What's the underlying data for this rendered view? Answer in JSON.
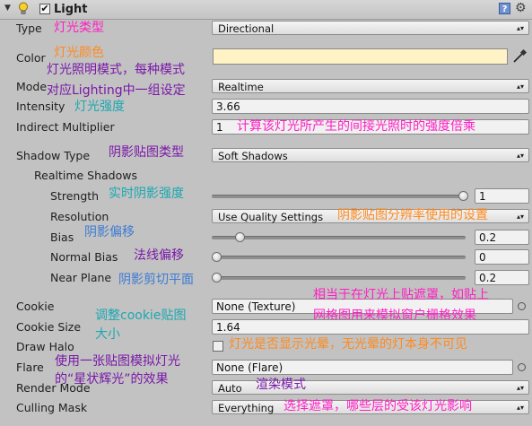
{
  "header": {
    "title": "Light",
    "enabled": true
  },
  "rows": {
    "type": {
      "label": "Type",
      "value": "Directional",
      "note": "灯光类型"
    },
    "color": {
      "label": "Color",
      "swatch": "#fff3c6",
      "note": "灯光颜色"
    },
    "mode": {
      "label": "Mode",
      "value": "Realtime",
      "note_line1": "灯光照明模式，每种模式",
      "note_line2": "对应Lighting中一组设定"
    },
    "intensity": {
      "label": "Intensity",
      "value": "3.66",
      "note": "灯光强度"
    },
    "indirect": {
      "label": "Indirect Multiplier",
      "value": "1",
      "note": "计算该灯光所产生的间接光照时的强度倍乘"
    },
    "shadow_type": {
      "label": "Shadow Type",
      "value": "Soft Shadows",
      "note": "阴影贴图类型"
    },
    "realtime_shadows": {
      "label": "Realtime Shadows"
    },
    "strength": {
      "label": "Strength",
      "value": "1",
      "level": 1.0,
      "note": "实时阴影强度"
    },
    "resolution": {
      "label": "Resolution",
      "value": "Use Quality Settings",
      "note": "阴影贴图分辨率使用的设置"
    },
    "bias": {
      "label": "Bias",
      "value": "0.2",
      "level": 0.1,
      "note": "阴影偏移"
    },
    "normal_bias": {
      "label": "Normal Bias",
      "value": "0",
      "level": 0.0,
      "note": "法线偏移"
    },
    "near_plane": {
      "label": "Near Plane",
      "value": "0.2",
      "level": 0.0,
      "note": "阴影剪切平面"
    },
    "cookie": {
      "label": "Cookie",
      "value": "None (Texture)",
      "note_line1": "相当于在灯光上贴遮罩，如贴上",
      "note_line2": "网格图用来模拟窗户栅格效果"
    },
    "cookie_size": {
      "label": "Cookie Size",
      "value": "1.64",
      "note_line1": "调整cookie贴图",
      "note_line2": "大小"
    },
    "draw_halo": {
      "label": "Draw Halo",
      "checked": false,
      "note": "灯光是否显示光晕，无光晕的灯本身不可见"
    },
    "flare": {
      "label": "Flare",
      "value": "None (Flare)",
      "note_line1": "使用一张贴图模拟灯光",
      "note_line2": "的“星状辉光”的效果"
    },
    "render_mode": {
      "label": "Render Mode",
      "value": "Auto",
      "note": "渲染模式"
    },
    "culling_mask": {
      "label": "Culling Mask",
      "value": "Everything",
      "note": "选择遮罩，哪些层的受该灯光影响"
    }
  }
}
